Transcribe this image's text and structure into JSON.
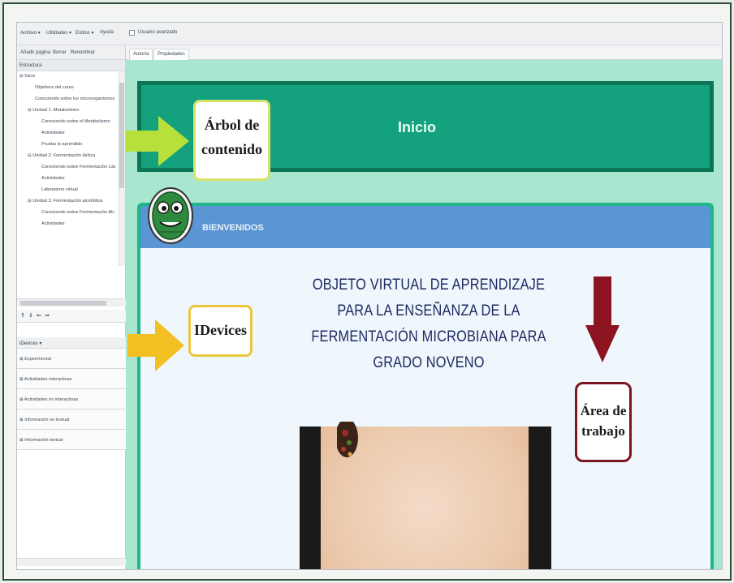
{
  "menu": {
    "items": [
      "Archivo ▾",
      "Utilidades ▾",
      "Estilos ▾",
      "Ayuda"
    ],
    "user_mode": "Usuario avanzado"
  },
  "page_tools": [
    "Añadir página",
    "Borrar",
    "Renombrar"
  ],
  "tree": {
    "heading": "Estructura",
    "items": [
      "⊟ Inicio",
      "Objetivos del curso",
      "Conociendo sobre los microorganismos",
      "⊟ Unidad 1: Metabolismo",
      "Conociendo sobre el Metabolismo",
      "Actividades",
      "Prueba lo aprendido",
      "⊟ Unidad 2: Fermentación láctica",
      "Conociendo sobre Fermentación Lác",
      "Actividades",
      "Laboratorio virtual",
      "⊟ Unidad 3: Fermentación alcohólica",
      "Conociendo sobre Fermentación Alc",
      "Actividades"
    ]
  },
  "nav_arrows": [
    "⇑",
    "⇓",
    "⇐",
    "⇒"
  ],
  "idevices": {
    "heading": "iDevices ▾",
    "groups": [
      "⊞ Experimental",
      "⊞ Actividades interactivas",
      "⊞ Actividades no interactivas",
      "⊞ Información no textual",
      "⊞ Información textual"
    ]
  },
  "tabs": [
    "Autoría",
    "Propiedades"
  ],
  "content": {
    "header_title": "Inicio",
    "panel_title": "BIENVENIDOS",
    "ova_title_lines": [
      "OBJETO VIRTUAL DE APRENDIZAJE",
      "PARA LA ENSEÑANZA DE LA",
      "FERMENTACIÓN MICROBIANA PARA",
      "GRADO NOVENO"
    ]
  },
  "annotations": {
    "arbol": [
      "Árbol de",
      "contenido"
    ],
    "idevices": "IDevices",
    "area": [
      "Área de",
      "trabajo"
    ]
  },
  "colors": {
    "header_green": "#14a17d",
    "content_bg": "#a9e6cf",
    "panel_blue": "#5b95d4",
    "arrow_green": "#b8e03a",
    "arrow_yellow": "#f2c022",
    "arrow_red": "#8c1420"
  }
}
